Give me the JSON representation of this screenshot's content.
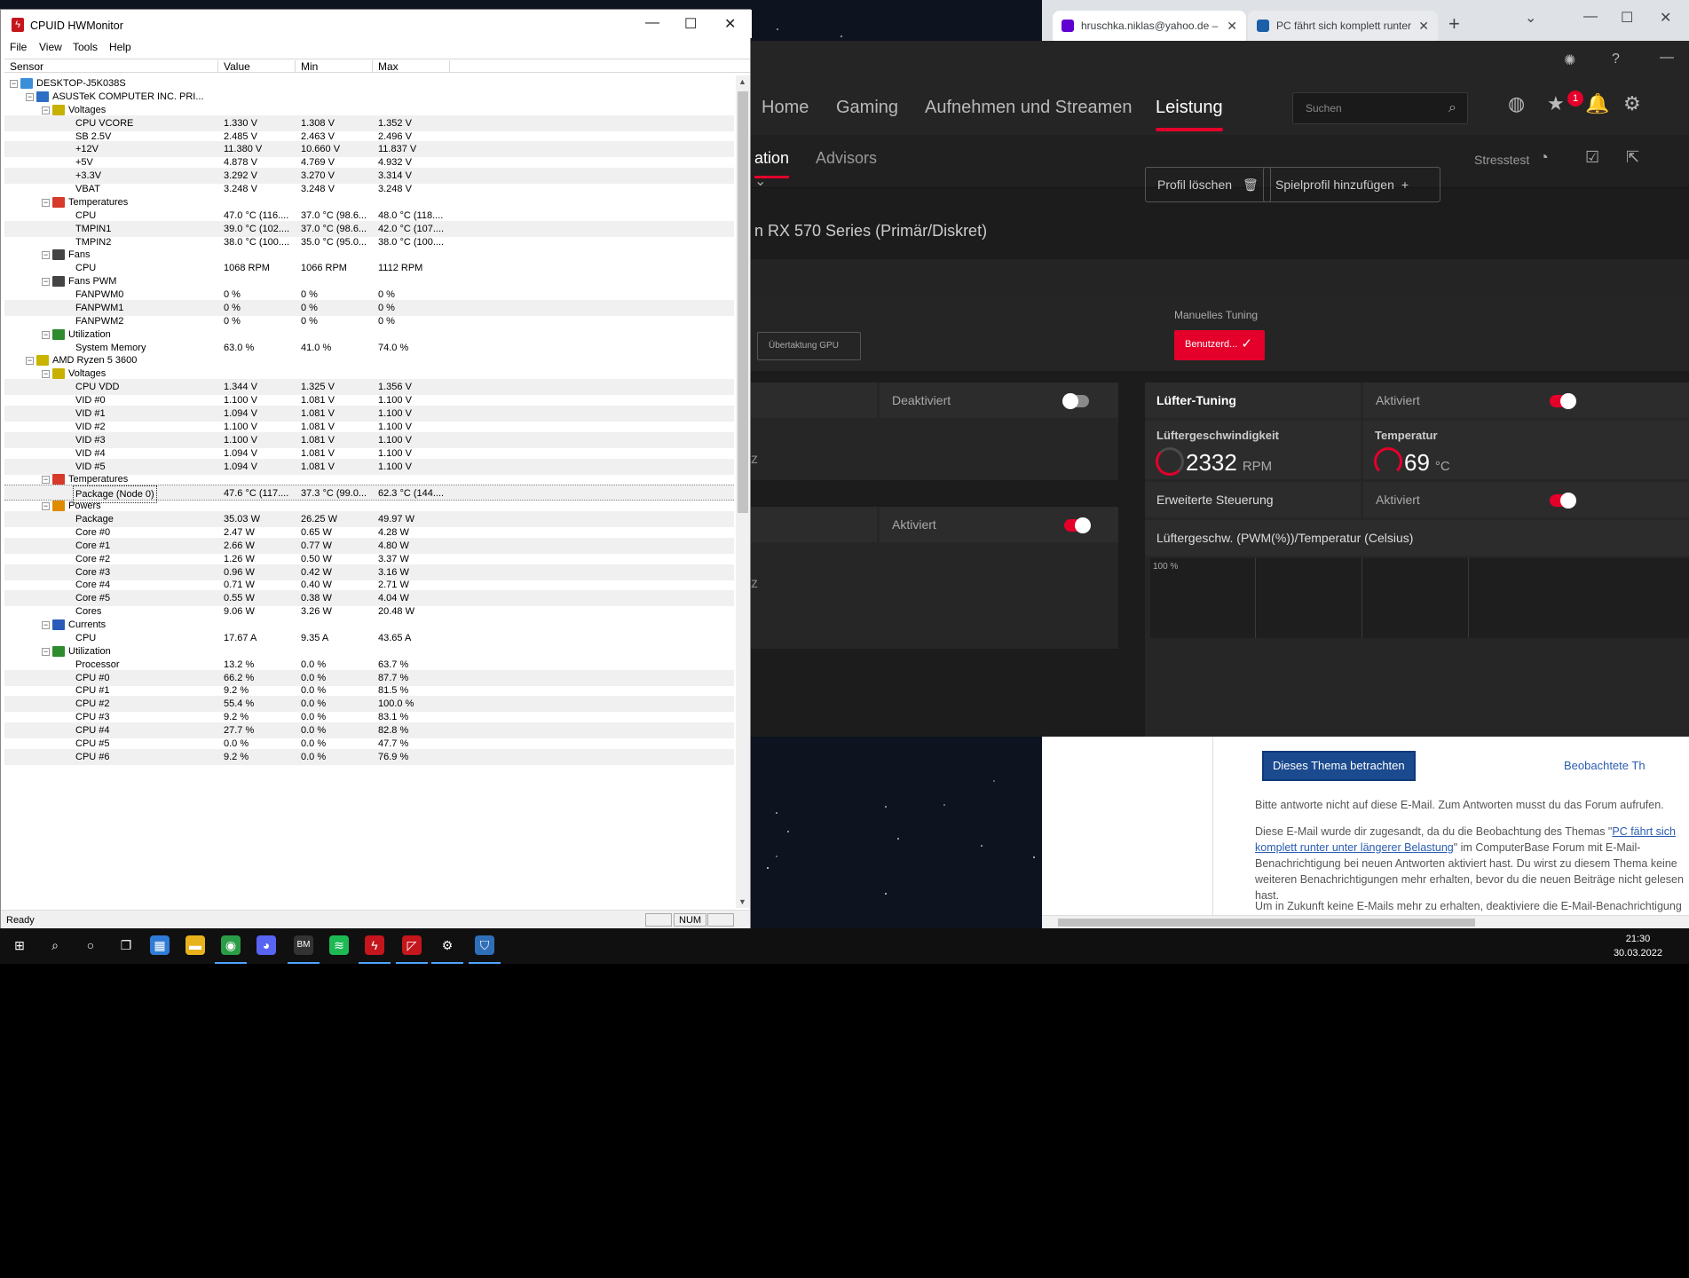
{
  "browser": {
    "tabs": [
      {
        "label": "hruschka.niklas@yahoo.de –",
        "icon": "yahoo-mail-icon"
      },
      {
        "label": "PC fährt sich komplett runter",
        "icon": "computerbase-icon"
      }
    ],
    "mail": {
      "button": "Dieses Thema betrachten",
      "observe_link": "Beobachtete Th",
      "p1": "Bitte antworte nicht auf diese E-Mail. Zum Antworten musst du das Forum aufrufen.",
      "p2a": "Diese E-Mail wurde dir zugesandt, da du die Beobachtung des Themas \"",
      "p2link": "PC fährt sich komplett runter unter längerer Belastung",
      "p2b": "\" im ComputerBase Forum mit E-Mail-Benachrichtigung bei neuen Antworten aktiviert hast. Du wirst zu diesem Thema keine weiteren Benachrichtigungen mehr erhalten, bevor du die neuen Beiträge nicht gelesen hast.",
      "p3": "Um in Zukunft keine E-Mails mehr zu erhalten, deaktiviere die E-Mail-Benachrichtigung"
    }
  },
  "amd": {
    "nav": [
      "Home",
      "Gaming",
      "Aufnehmen und Streamen",
      "Leistung"
    ],
    "search_placeholder": "Suchen",
    "notification_count": "1",
    "subnav": {
      "active": "ation",
      "advisors": "Advisors",
      "stresstest": "Stresstest"
    },
    "buttons": {
      "delete_profile": "Profil löschen",
      "add_game_profile": "Spielprofil hinzufügen"
    },
    "gpu_name": "n RX 570 Series (Primär/Diskret)",
    "manual_tuning_label": "Manuelles Tuning",
    "overclock_gpu": "Übertaktung GPU",
    "custom_button": "Benutzerd...",
    "left_cells": [
      {
        "state": "Deaktiviert",
        "on": false
      },
      {
        "state": "Aktiviert",
        "on": true
      }
    ],
    "left_labels": [
      "z",
      "z"
    ],
    "fan_tuning": {
      "title": "Lüfter-Tuning",
      "state": "Aktiviert"
    },
    "fan_speed": {
      "label": "Lüftergeschwindigkeit",
      "value": "2332",
      "unit": "RPM"
    },
    "temperature": {
      "label": "Temperatur",
      "value": "69",
      "unit": "°C"
    },
    "advanced_control": {
      "label": "Erweiterte Steuerung",
      "state": "Aktiviert"
    },
    "fan_curve_title": "Lüftergeschw. (PWM(%))/Temperatur (Celsius)",
    "fan_curve_ytick": "100 %"
  },
  "hwmonitor": {
    "title": "CPUID HWMonitor",
    "menu": [
      "File",
      "View",
      "Tools",
      "Help"
    ],
    "columns": [
      "Sensor",
      "Value",
      "Min",
      "Max"
    ],
    "rows": [
      {
        "lvl": 0,
        "type": "computer",
        "name": "DESKTOP-J5K038S"
      },
      {
        "lvl": 1,
        "type": "board",
        "name": "ASUSTeK COMPUTER INC. PRI..."
      },
      {
        "lvl": 2,
        "type": "voltage",
        "name": "Voltages"
      },
      {
        "lvl": 3,
        "name": "CPU VCORE",
        "v": "1.330 V",
        "mn": "1.308 V",
        "mx": "1.352 V"
      },
      {
        "lvl": 3,
        "name": "SB 2.5V",
        "v": "2.485 V",
        "mn": "2.463 V",
        "mx": "2.496 V"
      },
      {
        "lvl": 3,
        "name": "+12V",
        "v": "11.380 V",
        "mn": "10.660 V",
        "mx": "11.837 V"
      },
      {
        "lvl": 3,
        "name": "+5V",
        "v": "4.878 V",
        "mn": "4.769 V",
        "mx": "4.932 V"
      },
      {
        "lvl": 3,
        "name": "+3.3V",
        "v": "3.292 V",
        "mn": "3.270 V",
        "mx": "3.314 V"
      },
      {
        "lvl": 3,
        "name": "VBAT",
        "v": "3.248 V",
        "mn": "3.248 V",
        "mx": "3.248 V"
      },
      {
        "lvl": 2,
        "type": "temp",
        "name": "Temperatures"
      },
      {
        "lvl": 3,
        "name": "CPU",
        "v": "47.0 °C (116....",
        "mn": "37.0 °C (98.6...",
        "mx": "48.0 °C (118...."
      },
      {
        "lvl": 3,
        "name": "TMPIN1",
        "v": "39.0 °C (102....",
        "mn": "37.0 °C (98.6...",
        "mx": "42.0 °C (107...."
      },
      {
        "lvl": 3,
        "name": "TMPIN2",
        "v": "38.0 °C (100....",
        "mn": "35.0 °C (95.0...",
        "mx": "38.0 °C (100...."
      },
      {
        "lvl": 2,
        "type": "fan",
        "name": "Fans"
      },
      {
        "lvl": 3,
        "name": "CPU",
        "v": "1068 RPM",
        "mn": "1066 RPM",
        "mx": "1112 RPM"
      },
      {
        "lvl": 2,
        "type": "fan",
        "name": "Fans PWM"
      },
      {
        "lvl": 3,
        "name": "FANPWM0",
        "v": "0 %",
        "mn": "0 %",
        "mx": "0 %"
      },
      {
        "lvl": 3,
        "name": "FANPWM1",
        "v": "0 %",
        "mn": "0 %",
        "mx": "0 %"
      },
      {
        "lvl": 3,
        "name": "FANPWM2",
        "v": "0 %",
        "mn": "0 %",
        "mx": "0 %"
      },
      {
        "lvl": 2,
        "type": "util",
        "name": "Utilization"
      },
      {
        "lvl": 3,
        "name": "System Memory",
        "v": "63.0 %",
        "mn": "41.0 %",
        "mx": "74.0 %"
      },
      {
        "lvl": 1,
        "type": "cpu",
        "name": "AMD Ryzen 5 3600"
      },
      {
        "lvl": 2,
        "type": "voltage",
        "name": "Voltages"
      },
      {
        "lvl": 3,
        "name": "CPU VDD",
        "v": "1.344 V",
        "mn": "1.325 V",
        "mx": "1.356 V"
      },
      {
        "lvl": 3,
        "name": "VID #0",
        "v": "1.100 V",
        "mn": "1.081 V",
        "mx": "1.100 V"
      },
      {
        "lvl": 3,
        "name": "VID #1",
        "v": "1.094 V",
        "mn": "1.081 V",
        "mx": "1.100 V"
      },
      {
        "lvl": 3,
        "name": "VID #2",
        "v": "1.100 V",
        "mn": "1.081 V",
        "mx": "1.100 V"
      },
      {
        "lvl": 3,
        "name": "VID #3",
        "v": "1.100 V",
        "mn": "1.081 V",
        "mx": "1.100 V"
      },
      {
        "lvl": 3,
        "name": "VID #4",
        "v": "1.094 V",
        "mn": "1.081 V",
        "mx": "1.100 V"
      },
      {
        "lvl": 3,
        "name": "VID #5",
        "v": "1.094 V",
        "mn": "1.081 V",
        "mx": "1.100 V"
      },
      {
        "lvl": 2,
        "type": "temp",
        "name": "Temperatures"
      },
      {
        "lvl": 3,
        "name": "Package (Node 0)",
        "v": "47.6 °C (117....",
        "mn": "37.3 °C (99.0...",
        "mx": "62.3 °C (144....",
        "selected": true
      },
      {
        "lvl": 2,
        "type": "power",
        "name": "Powers"
      },
      {
        "lvl": 3,
        "name": "Package",
        "v": "35.03 W",
        "mn": "26.25 W",
        "mx": "49.97 W"
      },
      {
        "lvl": 3,
        "name": "Core #0",
        "v": "2.47 W",
        "mn": "0.65 W",
        "mx": "4.28 W"
      },
      {
        "lvl": 3,
        "name": "Core #1",
        "v": "2.66 W",
        "mn": "0.77 W",
        "mx": "4.80 W"
      },
      {
        "lvl": 3,
        "name": "Core #2",
        "v": "1.26 W",
        "mn": "0.50 W",
        "mx": "3.37 W"
      },
      {
        "lvl": 3,
        "name": "Core #3",
        "v": "0.96 W",
        "mn": "0.42 W",
        "mx": "3.16 W"
      },
      {
        "lvl": 3,
        "name": "Core #4",
        "v": "0.71 W",
        "mn": "0.40 W",
        "mx": "2.71 W"
      },
      {
        "lvl": 3,
        "name": "Core #5",
        "v": "0.55 W",
        "mn": "0.38 W",
        "mx": "4.04 W"
      },
      {
        "lvl": 3,
        "name": "Cores",
        "v": "9.06 W",
        "mn": "3.26 W",
        "mx": "20.48 W"
      },
      {
        "lvl": 2,
        "type": "current",
        "name": "Currents"
      },
      {
        "lvl": 3,
        "name": "CPU",
        "v": "17.67 A",
        "mn": "9.35 A",
        "mx": "43.65 A"
      },
      {
        "lvl": 2,
        "type": "util",
        "name": "Utilization"
      },
      {
        "lvl": 3,
        "name": "Processor",
        "v": "13.2 %",
        "mn": "0.0 %",
        "mx": "63.7 %"
      },
      {
        "lvl": 3,
        "name": "CPU #0",
        "v": "66.2 %",
        "mn": "0.0 %",
        "mx": "87.7 %"
      },
      {
        "lvl": 3,
        "name": "CPU #1",
        "v": "9.2 %",
        "mn": "0.0 %",
        "mx": "81.5 %"
      },
      {
        "lvl": 3,
        "name": "CPU #2",
        "v": "55.4 %",
        "mn": "0.0 %",
        "mx": "100.0 %"
      },
      {
        "lvl": 3,
        "name": "CPU #3",
        "v": "9.2 %",
        "mn": "0.0 %",
        "mx": "83.1 %"
      },
      {
        "lvl": 3,
        "name": "CPU #4",
        "v": "27.7 %",
        "mn": "0.0 %",
        "mx": "82.8 %"
      },
      {
        "lvl": 3,
        "name": "CPU #5",
        "v": "0.0 %",
        "mn": "0.0 %",
        "mx": "47.7 %"
      },
      {
        "lvl": 3,
        "name": "CPU #6",
        "v": "9.2 %",
        "mn": "0.0 %",
        "mx": "76.9 %"
      }
    ],
    "status": "Ready",
    "num": "NUM"
  },
  "taskbar": {
    "apps": [
      {
        "name": "windows-start-icon",
        "color": "#101010",
        "glyph": "⊞",
        "active": false
      },
      {
        "name": "search-icon",
        "color": "#101010",
        "glyph": "⌕",
        "active": false
      },
      {
        "name": "cortana-icon",
        "color": "#101010",
        "glyph": "○",
        "active": false
      },
      {
        "name": "task-view-icon",
        "color": "#101010",
        "glyph": "❐",
        "active": false
      },
      {
        "name": "microsoft-store-icon",
        "color": "#2f7bd6",
        "glyph": "▦",
        "active": false
      },
      {
        "name": "file-explorer-icon",
        "color": "#e8b21c",
        "glyph": "▬",
        "active": false
      },
      {
        "name": "chrome-icon",
        "color": "#2b9c46",
        "glyph": "◉",
        "active": true
      },
      {
        "name": "discord-icon",
        "color": "#5865f2",
        "glyph": "◕",
        "active": false
      },
      {
        "name": "bkm-app-icon",
        "color": "#333333",
        "glyph": "BM",
        "active": true
      },
      {
        "name": "spotify-icon",
        "color": "#1db954",
        "glyph": "≋",
        "active": false
      },
      {
        "name": "hwmonitor-icon",
        "color": "#c4161c",
        "glyph": "ϟ",
        "active": true
      },
      {
        "name": "amd-radeon-icon",
        "color": "#c4161c",
        "glyph": "◸",
        "active": true
      },
      {
        "name": "settings-icon",
        "color": "#101010",
        "glyph": "⚙",
        "active": true
      },
      {
        "name": "shield-app-icon",
        "color": "#2f6fb8",
        "glyph": "⛉",
        "active": true
      }
    ],
    "time": "21:30",
    "date": "30.03.2022"
  }
}
